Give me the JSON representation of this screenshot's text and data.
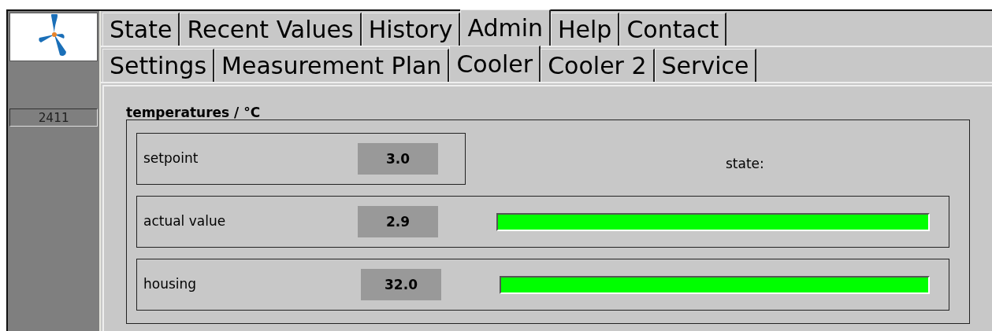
{
  "sidebar": {
    "counter": "2411"
  },
  "tabs": [
    {
      "label": "State",
      "selected": false
    },
    {
      "label": "Recent Values",
      "selected": false
    },
    {
      "label": "History",
      "selected": false
    },
    {
      "label": "Admin",
      "selected": true
    },
    {
      "label": "Help",
      "selected": false
    },
    {
      "label": "Contact",
      "selected": false
    }
  ],
  "subtabs": [
    {
      "label": "Settings",
      "selected": false
    },
    {
      "label": "Measurement Plan",
      "selected": false
    },
    {
      "label": "Cooler",
      "selected": true
    },
    {
      "label": "Cooler 2",
      "selected": false
    },
    {
      "label": "Service",
      "selected": false
    }
  ],
  "group": {
    "title": "temperatures / °C",
    "state_label": "state:",
    "rows": [
      {
        "label": "setpoint",
        "value": "3.0"
      },
      {
        "label": "actual value",
        "value": "2.9",
        "color": "#00ff00"
      },
      {
        "label": "housing",
        "value": "32.0",
        "color": "#00ff00"
      }
    ]
  }
}
